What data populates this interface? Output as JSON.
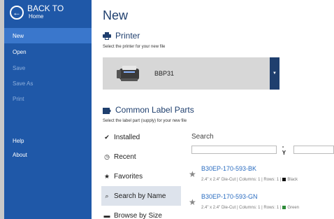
{
  "sidebar": {
    "back_title": "BACK TO",
    "back_sub": "Home",
    "items": [
      {
        "label": "New"
      },
      {
        "label": "Open"
      },
      {
        "label": "Save"
      },
      {
        "label": "Save As"
      },
      {
        "label": "Print"
      },
      {
        "label": "Help"
      },
      {
        "label": "About"
      }
    ]
  },
  "main": {
    "title": "New",
    "printer": {
      "heading": "Printer",
      "subtitle": "Select the printer for your new file",
      "selected": "BBP31"
    },
    "label_parts": {
      "heading": "Common Label Parts",
      "subtitle": "Select the label part (supply) for your new file"
    },
    "tabs": [
      {
        "label": "Installed",
        "icon": "check-icon"
      },
      {
        "label": "Recent",
        "icon": "clock-icon"
      },
      {
        "label": "Favorites",
        "icon": "star-icon"
      },
      {
        "label": "Search by Name",
        "icon": "search-icon"
      },
      {
        "label": "Browse by Size",
        "icon": "folder-icon"
      }
    ],
    "search": {
      "label": "Search",
      "filter_y": "- Y"
    },
    "results": [
      {
        "name": "B30EP-170-593-BK",
        "desc_a": "2.4\" x 2.4\" Die-Cut  |  Columns: 1  |  Rows: 1  |",
        "color_label": "Black",
        "color": "#111111"
      },
      {
        "name": "B30EP-170-593-GN",
        "desc_a": "2.4\" x 2.4\" Die-Cut  |  Columns: 1  |  Rows: 1  |",
        "color_label": "Green",
        "color": "#2e8b3a"
      }
    ]
  },
  "colors": {
    "sidebar": "#1f58a8",
    "sidebar_active": "#3a77cc",
    "accent": "#1f3f6e",
    "link": "#2a6cc0"
  }
}
